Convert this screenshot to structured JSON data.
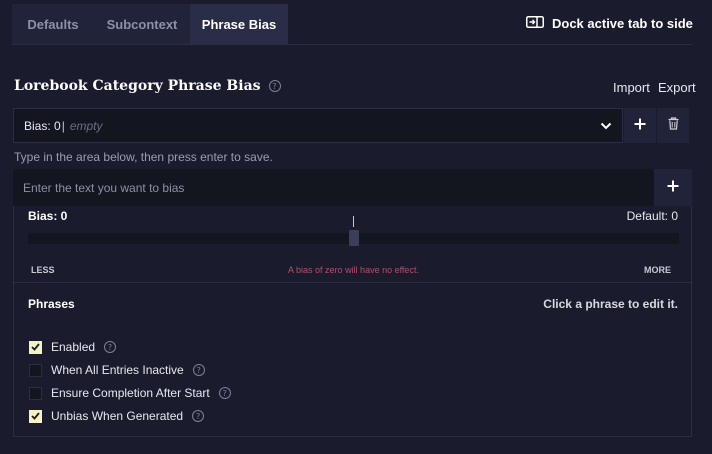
{
  "tabs": [
    {
      "label": "Defaults",
      "active": false
    },
    {
      "label": "Subcontext",
      "active": false
    },
    {
      "label": "Phrase Bias",
      "active": true
    }
  ],
  "dock": {
    "label": "Dock active tab to side",
    "icon": "dock-side-icon"
  },
  "section": {
    "title": "Lorebook Category Phrase Bias",
    "import_label": "Import",
    "export_label": "Export"
  },
  "bias_select": {
    "prefix": "Bias: 0",
    "separator": "|",
    "value": "empty"
  },
  "hint": "Type in the area below, then press enter to save.",
  "text_input": {
    "placeholder": "Enter the text you want to bias",
    "value": ""
  },
  "bias_slider": {
    "label": "Bias: 0",
    "default_label": "Default: 0",
    "value": 0,
    "less_label": "LESS",
    "more_label": "MORE",
    "note": "A bias of zero will have no effect."
  },
  "phrases": {
    "title": "Phrases",
    "hint": "Click a phrase to edit it."
  },
  "options": [
    {
      "label": "Enabled",
      "checked": true,
      "help": true
    },
    {
      "label": "When All Entries Inactive",
      "checked": false,
      "help": true
    },
    {
      "label": "Ensure Completion After Start",
      "checked": false,
      "help": true
    },
    {
      "label": "Unbias When Generated",
      "checked": true,
      "help": true
    }
  ],
  "colors": {
    "background": "#1a1c2e",
    "input_bg": "#13151f",
    "checkbox_on": "#f5f3c2",
    "warning_text": "#b0506a"
  }
}
